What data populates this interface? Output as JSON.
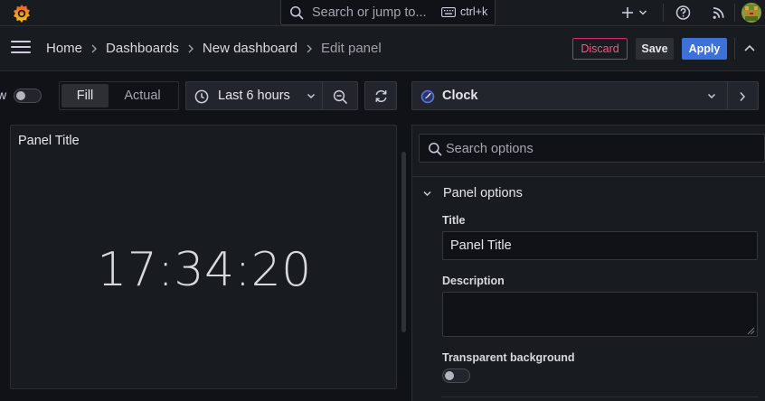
{
  "topbar": {
    "search_placeholder": "Search or jump to...",
    "shortcut": "ctrl+k"
  },
  "breadcrumbs": [
    "Home",
    "Dashboards",
    "New dashboard",
    "Edit panel"
  ],
  "actions": {
    "discard": "Discard",
    "save": "Save",
    "apply": "Apply"
  },
  "toolbar": {
    "toggle_label": "w",
    "toggle_on": false,
    "fill": "Fill",
    "actual": "Actual",
    "time_range": "Last 6 hours",
    "visualization": "Clock"
  },
  "panel": {
    "title": "Panel Title",
    "clock_value": "17:34:20"
  },
  "options": {
    "search_placeholder": "Search options",
    "section": "Panel options",
    "title_label": "Title",
    "title_value": "Panel Title",
    "description_label": "Description",
    "description_value": "",
    "transparent_label": "Transparent background",
    "transparent_on": false
  },
  "colors": {
    "accent": "#3d71d9",
    "discard": "#ff5286",
    "brand": "#f46800"
  },
  "icons": [
    "grafana-logo-icon",
    "search-icon",
    "keyboard-icon",
    "plus-icon",
    "chevron-down-icon",
    "help-icon",
    "rss-icon",
    "hamburger-icon",
    "clock-icon",
    "zoom-out-icon",
    "refresh-icon",
    "clock-panel-icon",
    "chevron-right-icon",
    "chevron-up-icon"
  ]
}
